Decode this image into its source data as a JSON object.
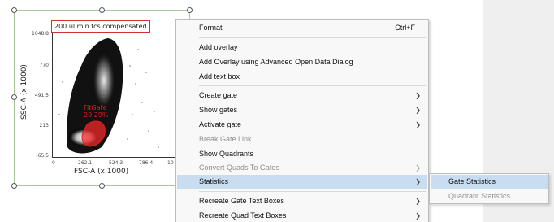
{
  "plot": {
    "title": "200 ul min.fcs compensated",
    "x_axis_label": "FSC-A (x 1000)",
    "y_axis_label": "SSC-A (x 1000)",
    "y_ticks": [
      "1048.8",
      "770",
      "491.5",
      "213",
      "-65.5"
    ],
    "x_ticks": [
      "0",
      "262.1",
      "524.3",
      "786.4",
      "10"
    ],
    "gate_label": "FitGate",
    "gate_percent": "20.29%",
    "gate_color": "#e02020"
  },
  "menu": {
    "format": {
      "label": "Format",
      "shortcut": "Ctrl+F"
    },
    "add_overlay": "Add overlay",
    "add_overlay_advanced": "Add Overlay using Advanced Open Data Dialog",
    "add_text_box": "Add text box",
    "create_gate": "Create gate",
    "show_gates": "Show gates",
    "activate_gate": "Activate gate",
    "break_gate_link": "Break Gate Link",
    "show_quadrants": "Show Quadrants",
    "convert_quads": "Convert Quads To Gates",
    "statistics": "Statistics",
    "recreate_gate_text": "Recreate Gate Text Boxes",
    "recreate_quad_text": "Recreate Quad Text Boxes"
  },
  "submenu": {
    "gate_statistics": "Gate Statistics",
    "quadrant_statistics": "Quadrant Statistics"
  },
  "colors": {
    "highlight": "#c9ddf1",
    "disabled_text": "#8e8e8e",
    "selection_frame": "#a9c79a"
  }
}
